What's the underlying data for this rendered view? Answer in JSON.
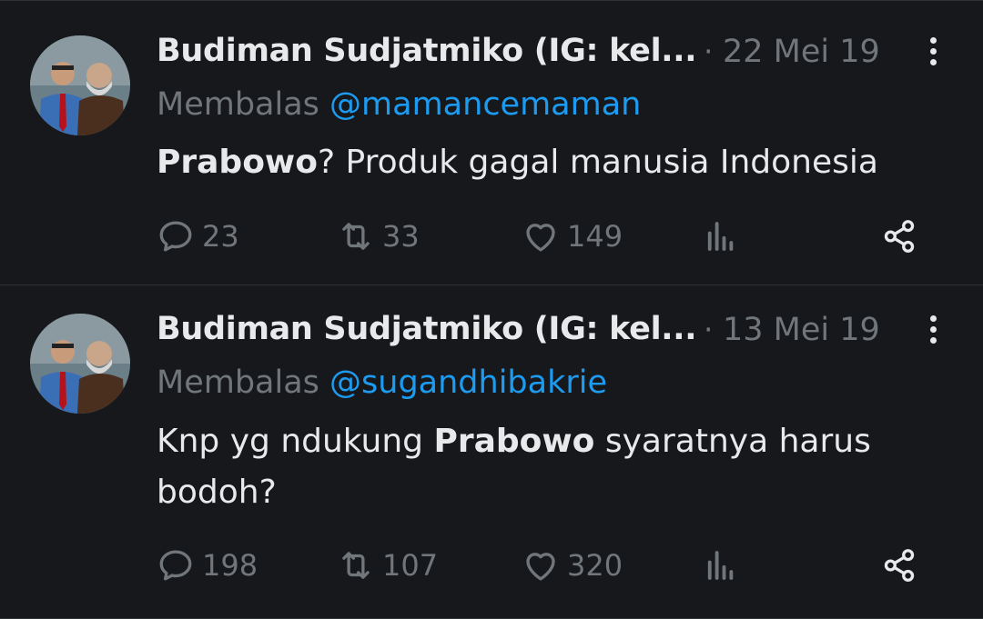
{
  "tweets": [
    {
      "author": "Budiman Sudjatmiko (IG: kel...",
      "separator": "·",
      "date": "22 Mei 19",
      "reply_prefix": "Membalas",
      "reply_handle": "@mamancemaman",
      "text_bold": "Prabowo",
      "text_rest": "? Produk gagal manusia Indonesia",
      "replies": "23",
      "retweets": "33",
      "likes": "149"
    },
    {
      "author": "Budiman Sudjatmiko (IG: kel...",
      "separator": "·",
      "date": "13 Mei 19",
      "reply_prefix": "Membalas",
      "reply_handle": "@sugandhibakrie",
      "text_pre": "Knp yg ndukung ",
      "text_bold": "Prabowo",
      "text_rest": " syaratnya harus bodoh?",
      "replies": "198",
      "retweets": "107",
      "likes": "320"
    }
  ],
  "icons": {
    "reply": "reply-icon",
    "retweet": "retweet-icon",
    "like": "heart-icon",
    "views": "views-icon",
    "share": "share-icon",
    "more": "more-icon"
  },
  "colors": {
    "background": "#16181c",
    "text": "#e7e9ea",
    "muted": "#71767b",
    "link": "#1d9bf0"
  }
}
